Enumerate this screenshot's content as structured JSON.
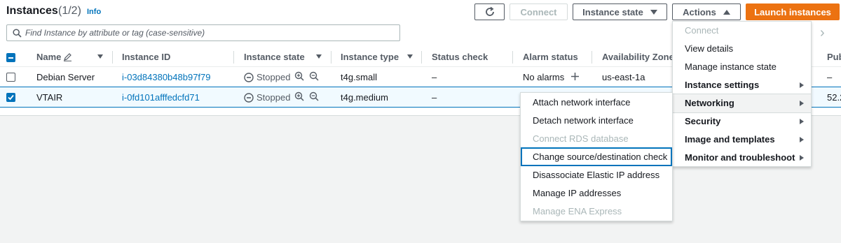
{
  "header": {
    "title": "Instances",
    "count": "(1/2)",
    "info": "Info"
  },
  "toolbar": {
    "refresh_icon": "refresh-icon",
    "connect": "Connect",
    "instance_state": "Instance state",
    "actions": "Actions",
    "launch": "Launch instances"
  },
  "search": {
    "placeholder": "Find Instance by attribute or tag (case-sensitive)"
  },
  "table": {
    "columns": [
      "Name",
      "Instance ID",
      "Instance state",
      "Instance type",
      "Status check",
      "Alarm status",
      "Availability Zone",
      "Pub"
    ],
    "rows": [
      {
        "name": "Debian Server",
        "id": "i-03d84380b48b97f79",
        "state": "Stopped",
        "type": "t4g.small",
        "status": "–",
        "alarm": "No alarms",
        "az": "us-east-1a",
        "pub": "–",
        "selected": false
      },
      {
        "name": "VTAIR",
        "id": "i-0fd101afffedcfd71",
        "state": "Stopped",
        "type": "t4g.medium",
        "status": "–",
        "alarm": "",
        "az": "",
        "pub": "52.2",
        "selected": true
      }
    ]
  },
  "actions_menu": [
    {
      "label": "Connect",
      "disabled": true
    },
    {
      "label": "View details"
    },
    {
      "label": "Manage instance state"
    },
    {
      "label": "Instance settings",
      "submenu": true
    },
    {
      "label": "Networking",
      "submenu": true,
      "active": true
    },
    {
      "label": "Security",
      "submenu": true
    },
    {
      "label": "Image and templates",
      "submenu": true
    },
    {
      "label": "Monitor and troubleshoot",
      "submenu": true
    }
  ],
  "networking_menu": [
    {
      "label": "Attach network interface"
    },
    {
      "label": "Detach network interface"
    },
    {
      "label": "Connect RDS database",
      "disabled": true
    },
    {
      "label": "Change source/destination check",
      "focused": true
    },
    {
      "label": "Disassociate Elastic IP address"
    },
    {
      "label": "Manage IP addresses"
    },
    {
      "label": "Manage ENA Express",
      "disabled": true
    }
  ],
  "colors": {
    "accent": "#0073bb",
    "primary": "#ec7211",
    "muted": "#545b64",
    "disabled": "#aab7b8"
  }
}
